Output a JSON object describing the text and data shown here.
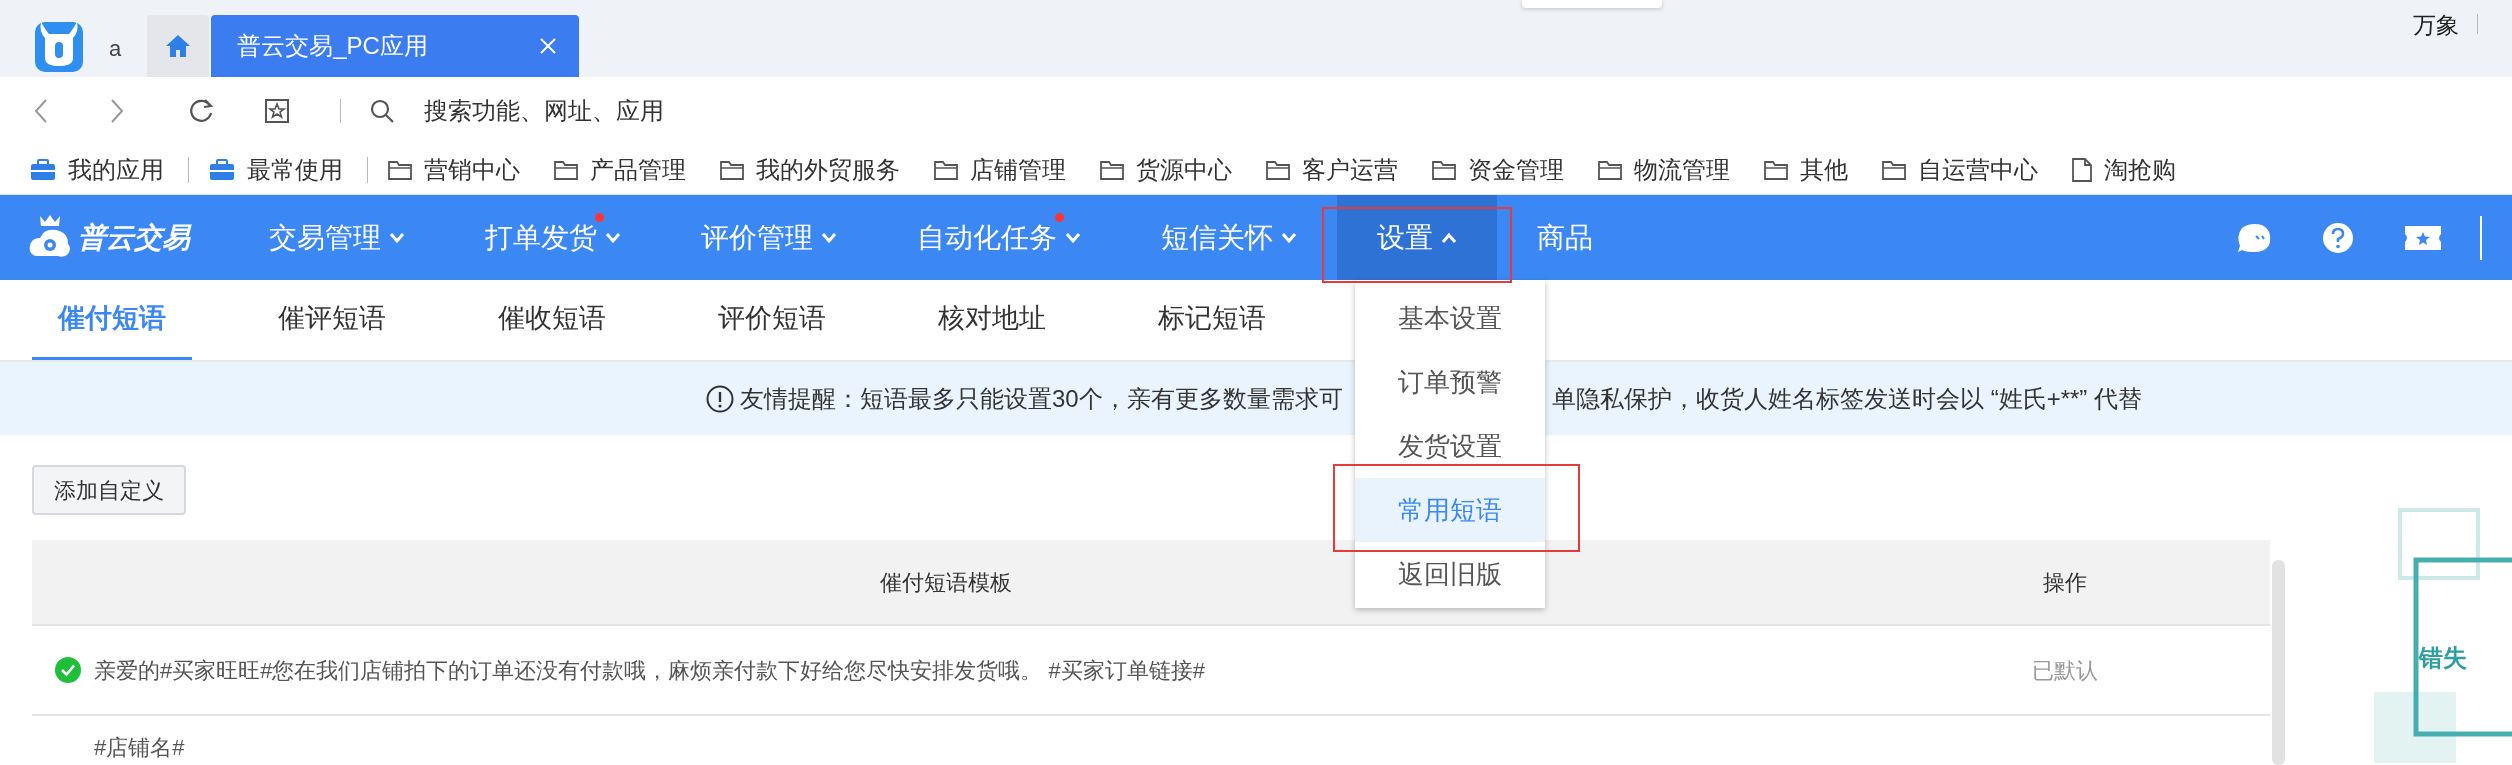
{
  "browser": {
    "profile_label": "a",
    "tabs": [
      {
        "kind": "home",
        "selected": false
      },
      {
        "kind": "page",
        "label": "普云交易_PC应用",
        "selected": true
      }
    ],
    "top_right_label": "万象",
    "address_placeholder": "搜索功能、网址、应用",
    "bookmarks": [
      {
        "kind": "app",
        "label": "我的应用"
      },
      {
        "kind": "app",
        "label": "最常使用"
      },
      {
        "kind": "folder",
        "label": "营销中心"
      },
      {
        "kind": "folder",
        "label": "产品管理"
      },
      {
        "kind": "folder",
        "label": "我的外贸服务"
      },
      {
        "kind": "folder",
        "label": "店铺管理"
      },
      {
        "kind": "folder",
        "label": "货源中心"
      },
      {
        "kind": "folder",
        "label": "客户运营"
      },
      {
        "kind": "folder",
        "label": "资金管理"
      },
      {
        "kind": "folder",
        "label": "物流管理"
      },
      {
        "kind": "folder",
        "label": "其他"
      },
      {
        "kind": "folder",
        "label": "自运营中心"
      },
      {
        "kind": "page",
        "label": "淘抢购"
      }
    ]
  },
  "app_nav": {
    "brand": "普云交易",
    "items": [
      {
        "label": "交易管理",
        "kind": "menu",
        "dot": false,
        "expanded": false,
        "selected": false,
        "highlighted": false
      },
      {
        "label": "打单发货",
        "kind": "menu",
        "dot": true,
        "expanded": false,
        "selected": false,
        "highlighted": false
      },
      {
        "label": "评价管理",
        "kind": "menu",
        "dot": false,
        "expanded": false,
        "selected": false,
        "highlighted": false
      },
      {
        "label": "自动化任务",
        "kind": "menu",
        "dot": true,
        "expanded": false,
        "selected": false,
        "highlighted": false
      },
      {
        "label": "短信关怀",
        "kind": "menu",
        "dot": false,
        "expanded": false,
        "selected": false,
        "highlighted": false
      },
      {
        "label": "设置",
        "kind": "menu",
        "dot": false,
        "expanded": true,
        "selected": true,
        "highlighted": true
      },
      {
        "label": "商品",
        "kind": "link",
        "dot": false,
        "expanded": false,
        "selected": false,
        "highlighted": false
      }
    ]
  },
  "settings_menu": {
    "items": [
      {
        "label": "基本设置",
        "selected": false,
        "highlighted": false
      },
      {
        "label": "订单预警",
        "selected": false,
        "highlighted": false
      },
      {
        "label": "发货设置",
        "selected": false,
        "highlighted": false
      },
      {
        "label": "常用短语",
        "selected": true,
        "highlighted": true
      },
      {
        "label": "返回旧版",
        "selected": false,
        "highlighted": false
      }
    ]
  },
  "sub_tabs": [
    {
      "label": "催付短语",
      "selected": true
    },
    {
      "label": "催评短语",
      "selected": false
    },
    {
      "label": "催收短语",
      "selected": false
    },
    {
      "label": "评价短语",
      "selected": false
    },
    {
      "label": "核对地址",
      "selected": false
    },
    {
      "label": "标记短语",
      "selected": false
    }
  ],
  "notice": {
    "parts": [
      "友情提醒：短语最多只能设置30个，亲有更多数量需求可",
      "单隐私保护，收货人姓名标签发送时会以 “姓氏+**” 代替"
    ]
  },
  "add_button": "添加自定义",
  "table": {
    "columns": [
      "催付短语模板",
      "操作"
    ],
    "rows": [
      {
        "text": "亲爱的#买家旺旺#您在我们店铺拍下的订单还没有付款哦，麻烦亲付款下好给您尽快安排发货哦。 #买家订单链接#",
        "is_default": true,
        "action": "已默认"
      },
      {
        "text": "#店铺名#",
        "is_default": false
      }
    ]
  },
  "promo": {
    "text": "错失"
  }
}
